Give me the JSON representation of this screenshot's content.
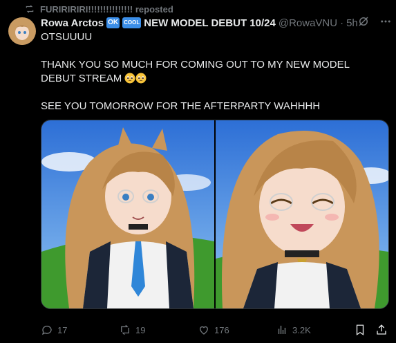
{
  "repost": {
    "icon": "repost-icon",
    "label": "FURIRIRIRI!!!!!!!!!!!!!!! reposted"
  },
  "author": {
    "name": "Rowa Arctos",
    "badge_ok": "OK",
    "badge_cool": "COOL",
    "title": "NEW MODEL DEBUT 10/24",
    "handle": "@RowaVNU",
    "dot": "·",
    "time": "5h"
  },
  "tweet": {
    "line1": "OTSUUUU",
    "line2": "THANK YOU SO MUCH FOR COMING OUT TO MY NEW MODEL DEBUT STREAM",
    "line3": "SEE YOU TOMORROW FOR THE AFTERPARTY WAHHHH"
  },
  "stats": {
    "replies": "17",
    "reposts": "19",
    "likes": "176",
    "views": "3.2K"
  },
  "colors": {
    "badge": "#3b8ee8",
    "muted": "#71767b",
    "text": "#e7e9ea"
  }
}
